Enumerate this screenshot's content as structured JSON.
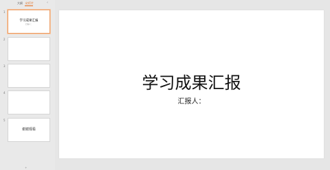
{
  "panel": {
    "tabs": [
      {
        "label": "大纲"
      },
      {
        "label": "幻灯片"
      }
    ],
    "collapse_icon": "‹"
  },
  "slides": [
    {
      "number": "1",
      "title": "学习成果汇报",
      "subtitle": "汇报人："
    },
    {
      "number": "2",
      "text": ""
    },
    {
      "number": "3",
      "text": ""
    },
    {
      "number": "4",
      "text": ""
    },
    {
      "number": "5",
      "text": "谢谢观看"
    }
  ],
  "current_slide": {
    "title": "学习成果汇报",
    "subtitle": "汇报人："
  },
  "colors": {
    "accent": "#e56c1c",
    "selected_border": "#ec9b62",
    "background": "#e6e6e6",
    "canvas": "#ffffff"
  }
}
